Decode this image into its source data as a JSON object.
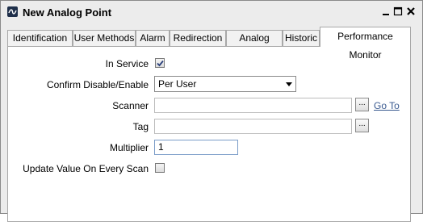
{
  "window": {
    "title": "New Analog Point"
  },
  "tabs": [
    {
      "label": "Identification"
    },
    {
      "label": "User Methods"
    },
    {
      "label": "Alarm"
    },
    {
      "label": "Redirection"
    },
    {
      "label": "Analog Point"
    },
    {
      "label": "Historic"
    },
    {
      "label": "Performance Monitor",
      "active": true
    }
  ],
  "form": {
    "in_service": {
      "label": "In Service",
      "checked": true
    },
    "confirm": {
      "label": "Confirm Disable/Enable",
      "value": "Per User"
    },
    "scanner": {
      "label": "Scanner",
      "value": "",
      "browse": "...",
      "goto": "Go To"
    },
    "tag": {
      "label": "Tag",
      "value": "",
      "browse": "..."
    },
    "multiplier": {
      "label": "Multiplier",
      "value": "1"
    },
    "update_every_scan": {
      "label": "Update Value On Every Scan",
      "checked": false
    }
  }
}
